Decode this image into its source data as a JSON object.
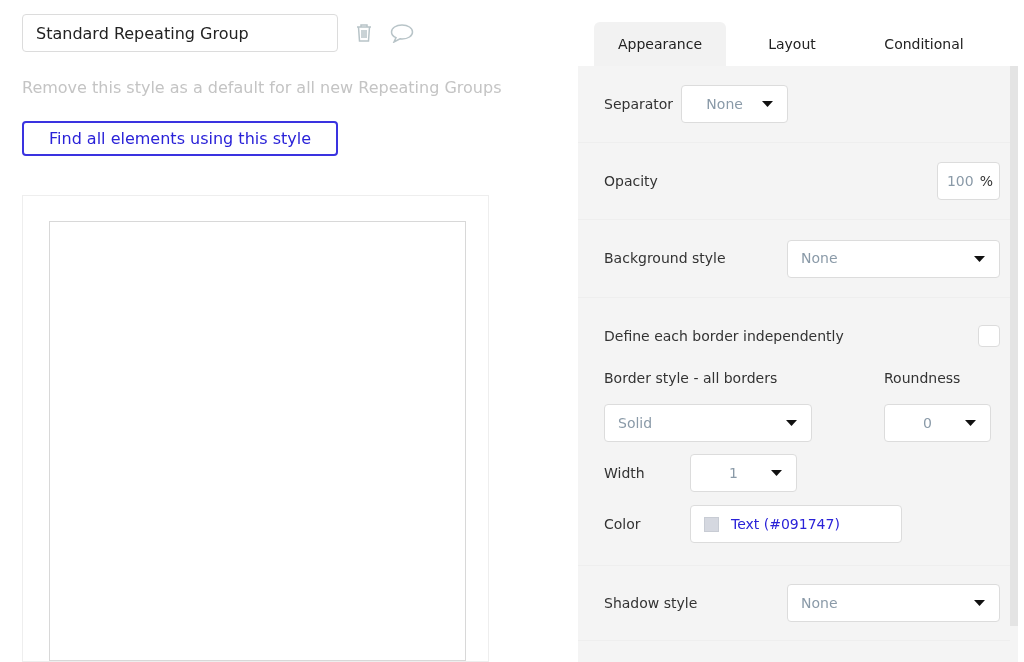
{
  "style_name": {
    "value": "Standard Repeating Group"
  },
  "remove_default_link": "Remove this style as a default for all new Repeating Groups",
  "find_button": "Find all elements using this style",
  "tabs": [
    {
      "label": "Appearance",
      "selected": true
    },
    {
      "label": "Layout",
      "selected": false
    },
    {
      "label": "Conditional",
      "selected": false
    }
  ],
  "separator": {
    "label": "Separator",
    "value": "None"
  },
  "opacity": {
    "label": "Opacity",
    "value": "100",
    "unit": "%"
  },
  "background_style": {
    "label": "Background style",
    "value": "None"
  },
  "border": {
    "independent_label": "Define each border independently",
    "independent_checked": false,
    "style_label": "Border style - all borders",
    "style_value": "Solid",
    "roundness_label": "Roundness",
    "roundness_value": "0",
    "width_label": "Width",
    "width_value": "1",
    "color_label": "Color",
    "color_value": "Text (#091747)"
  },
  "shadow_style": {
    "label": "Shadow style",
    "value": "None"
  }
}
